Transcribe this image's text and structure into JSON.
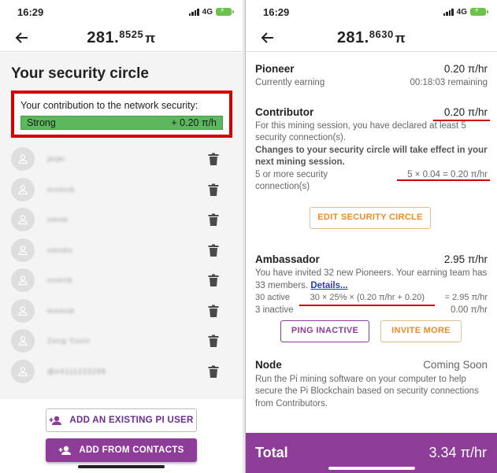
{
  "left": {
    "status": {
      "time": "16:29",
      "network": "4G"
    },
    "balance": {
      "main": "281.",
      "decimals": "8525",
      "unit": "π"
    },
    "title": "Your security circle",
    "contribution": {
      "label": "Your contribution to the network security:",
      "strength": "Strong",
      "rate": "+ 0.20 π/h"
    },
    "members": [
      {
        "name": "jkljkl"
      },
      {
        "name": "mnmnb"
      },
      {
        "name": "nmnb"
      },
      {
        "name": "nmnbn"
      },
      {
        "name": "nnmnb"
      },
      {
        "name": "mnmnb"
      },
      {
        "name": "Zeng Yuxin"
      },
      {
        "name": "@e4111223298"
      }
    ],
    "buttons": {
      "add_existing": "ADD AN EXISTING PI USER",
      "add_contacts": "ADD FROM CONTACTS"
    },
    "colors": {
      "highlight": "#d40000",
      "strong": "#5cb85c",
      "brand": "#8d3d97"
    }
  },
  "right": {
    "status": {
      "time": "16:29",
      "network": "4G"
    },
    "balance": {
      "main": "281.",
      "decimals": "8630",
      "unit": "π"
    },
    "pioneer": {
      "title": "Pioneer",
      "value": "0.20 π/hr",
      "sub": "Currently earning",
      "remaining": "00:18:03 remaining"
    },
    "contributor": {
      "title": "Contributor",
      "value": "0.20 π/hr",
      "desc": "For this mining session, you have declared at least 5 security connection(s).",
      "bold_note": "Changes to your security circle will take effect in your next mining session.",
      "req": "5 or more security connection(s)",
      "formula": "5 × 0.04 = 0.20 π/hr",
      "edit_button": "EDIT SECURITY CIRCLE"
    },
    "ambassador": {
      "title": "Ambassador",
      "value": "2.95 π/hr",
      "desc": "You have invited 32 new Pioneers. Your earning team has 33 members.",
      "details_link": "Details...",
      "active_label": "30 active",
      "active_formula": "30 × 25% × (0.20 π/hr + 0.20)",
      "active_value": "= 2.95 π/hr",
      "inactive_label": "3 inactive",
      "inactive_value": "0.00 π/hr",
      "ping_button": "PING INACTIVE",
      "invite_button": "INVITE MORE"
    },
    "node": {
      "title": "Node",
      "value": "Coming Soon",
      "desc": "Run the Pi mining software on your computer to help secure the Pi Blockchain based on security connections from Contributors."
    },
    "total": {
      "label": "Total",
      "value": "3.34 π/hr"
    }
  }
}
